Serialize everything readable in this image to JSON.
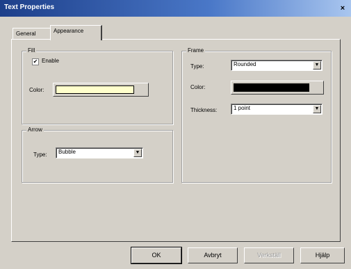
{
  "window": {
    "title": "Text Properties",
    "close_glyph": "×"
  },
  "tabs": [
    {
      "label": "General"
    },
    {
      "label": "Appearance"
    }
  ],
  "fill": {
    "legend": "Fill",
    "enable_label": "Enable",
    "enable_checked": true,
    "check_glyph": "✔",
    "color_label": "Color:",
    "color_value": "#ffffcc"
  },
  "arrow": {
    "legend": "Arrow",
    "type_label": "Type:",
    "type_value": "Bubble"
  },
  "frame": {
    "legend": "Frame",
    "type_label": "Type:",
    "type_value": "Rounded",
    "color_label": "Color:",
    "color_value": "#000000",
    "thickness_label": "Thickness:",
    "thickness_value": "1 point"
  },
  "buttons": {
    "ok": "OK",
    "cancel": "Avbryt",
    "apply": "Verkställ",
    "help": "Hjälp"
  }
}
